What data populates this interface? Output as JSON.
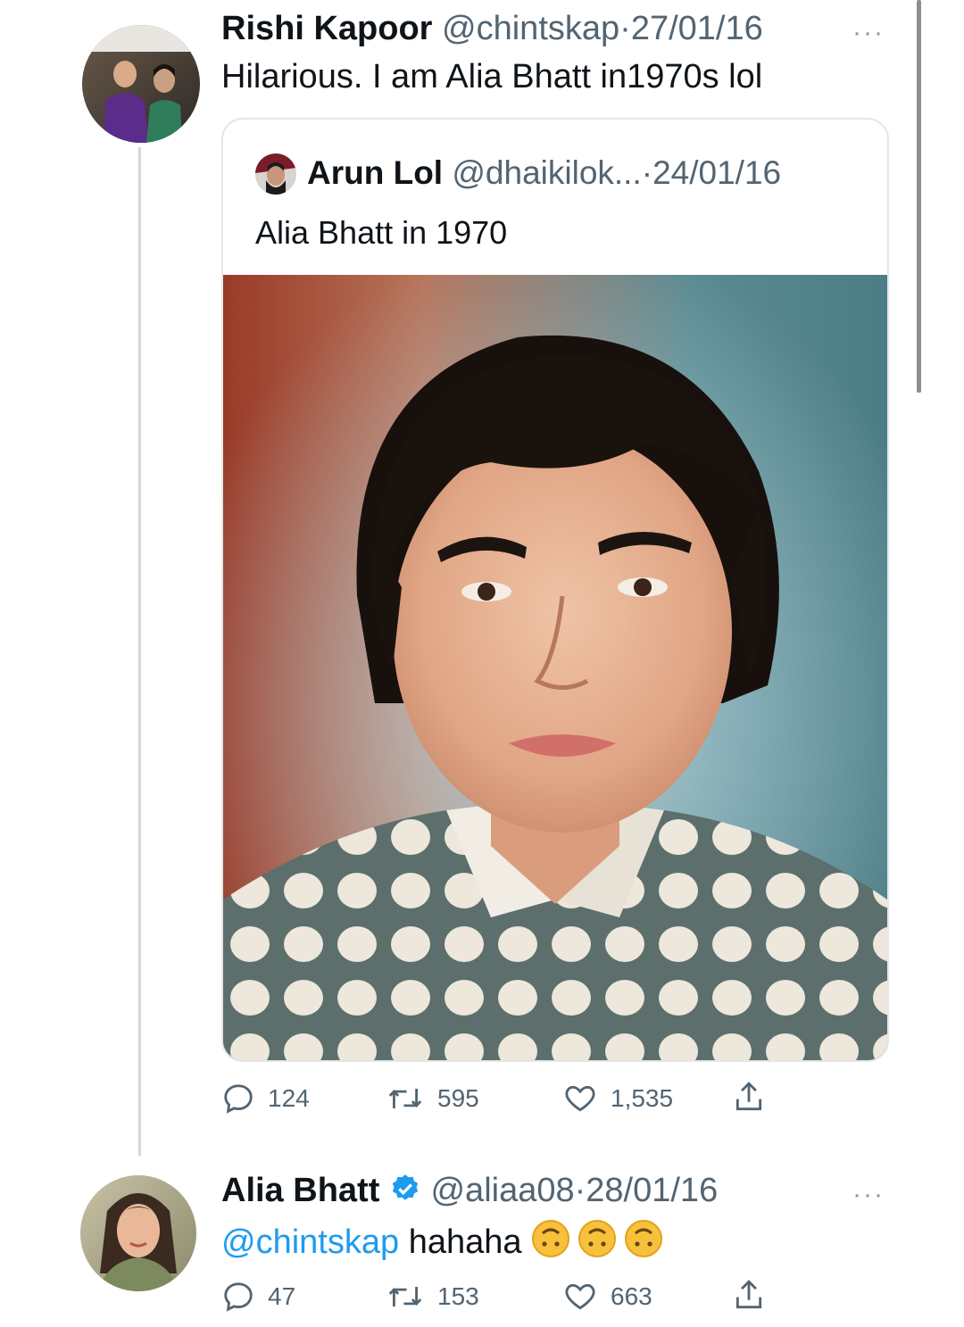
{
  "tweet1": {
    "display_name": "Rishi Kapoor",
    "handle": "@chintskap",
    "separator": "·",
    "date": "27/01/16",
    "text": "Hilarious. I am Alia Bhatt in1970s lol",
    "more": "···"
  },
  "quoted": {
    "display_name": "Arun Lol",
    "handle": "@dhaikilok...",
    "separator": "·",
    "date": "24/01/16",
    "text": "Alia Bhatt in 1970"
  },
  "tweet1_stats": {
    "replies": "124",
    "retweets": "595",
    "likes": "1,535"
  },
  "tweet2": {
    "display_name": "Alia Bhatt",
    "handle": "@aliaa08",
    "separator": "·",
    "date": "28/01/16",
    "mention": "@chintskap",
    "text": "hahaha",
    "more": "···",
    "emoji": "upside-down-face-emoji"
  },
  "tweet2_stats": {
    "replies": "47",
    "retweets": "153",
    "likes": "663"
  },
  "colors": {
    "link": "#1d9bf0",
    "muted": "#536471",
    "verified": "#1d9bf0"
  },
  "icons": [
    "reply-icon",
    "retweet-icon",
    "like-icon",
    "share-icon",
    "verified-badge-icon",
    "more-icon"
  ]
}
